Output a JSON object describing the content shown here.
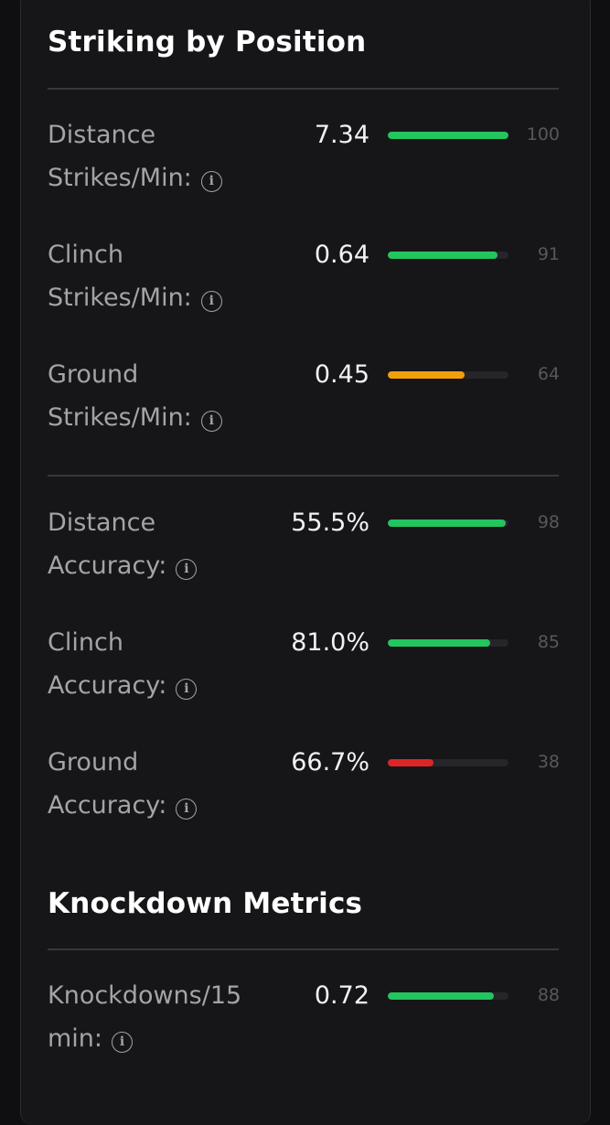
{
  "striking": {
    "title": "Striking by Position",
    "rows": [
      {
        "label_line1": "Distance",
        "label_line2": "Strikes/Min:",
        "value": "7.34",
        "percentile": 100,
        "bar_color": "#22c55e"
      },
      {
        "label_line1": "Clinch",
        "label_line2": "Strikes/Min:",
        "value": "0.64",
        "percentile": 91,
        "bar_color": "#22c55e"
      },
      {
        "label_line1": "Ground",
        "label_line2": "Strikes/Min:",
        "value": "0.45",
        "percentile": 64,
        "bar_color": "#f59e0b"
      },
      {
        "label_line1": "Distance",
        "label_line2": "Accuracy:",
        "value": "55.5%",
        "percentile": 98,
        "bar_color": "#22c55e"
      },
      {
        "label_line1": "Clinch",
        "label_line2": "Accuracy:",
        "value": "81.0%",
        "percentile": 85,
        "bar_color": "#22c55e"
      },
      {
        "label_line1": "Ground",
        "label_line2": "Accuracy:",
        "value": "66.7%",
        "percentile": 38,
        "bar_color": "#dc2626"
      }
    ]
  },
  "knockdown": {
    "title": "Knockdown Metrics",
    "rows": [
      {
        "label_line1": "Knockdowns/15",
        "label_line2": "min:",
        "value": "0.72",
        "percentile": 88,
        "bar_color": "#22c55e"
      }
    ]
  },
  "icons": {
    "info": "info-icon",
    "info_glyph": "i"
  }
}
